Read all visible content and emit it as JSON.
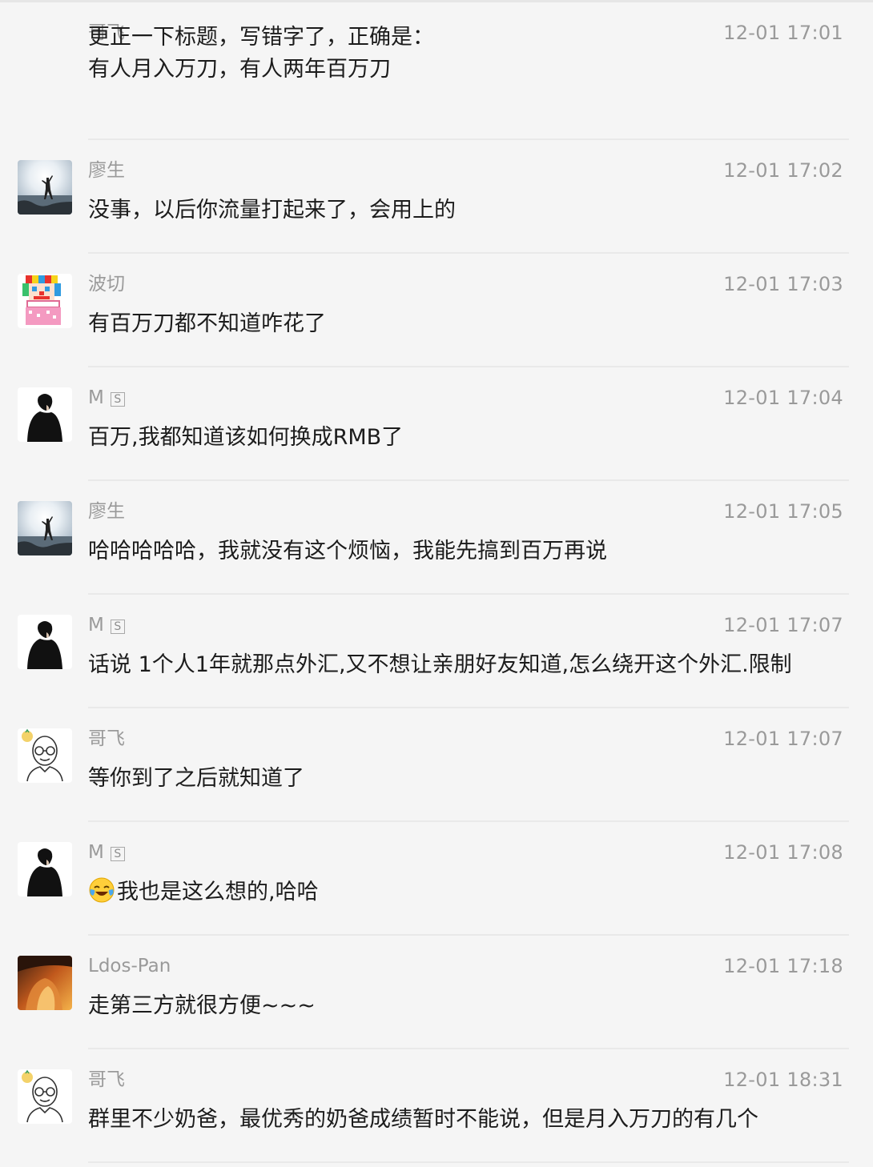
{
  "messages": [
    {
      "sender": "哥飞",
      "time": "12-01 17:01",
      "avatar": "none",
      "lines": [
        "更正一下标题，写错字了，正确是：",
        "有人月入万刀，有人两年百万刀"
      ]
    },
    {
      "sender": "廖生",
      "time": "12-01 17:02",
      "avatar": "silhouette-beach-photo",
      "lines": [
        "没事，以后你流量打起来了，会用上的"
      ]
    },
    {
      "sender": "波切",
      "time": "12-01 17:03",
      "avatar": "pixel-clown",
      "lines": [
        "有百万刀都不知道咋花了"
      ]
    },
    {
      "sender": "M",
      "sender_badge": "S",
      "time": "12-01 17:04",
      "avatar": "black-silhouette",
      "lines": [
        "百万,我都知道该如何换成RMB了"
      ]
    },
    {
      "sender": "廖生",
      "time": "12-01 17:05",
      "avatar": "silhouette-beach-photo",
      "lines": [
        "哈哈哈哈哈，我就没有这个烦恼，我能先搞到百万再说"
      ]
    },
    {
      "sender": "M",
      "sender_badge": "S",
      "time": "12-01 17:07",
      "avatar": "black-silhouette",
      "lines": [
        "话说 1个人1年就那点外汇,又不想让亲朋好友知道,怎么绕开这个外汇.限制"
      ]
    },
    {
      "sender": "哥飞",
      "time": "12-01 17:07",
      "avatar": "bald-glasses-cartoon",
      "lines": [
        "等你到了之后就知道了"
      ]
    },
    {
      "sender": "M",
      "sender_badge": "S",
      "time": "12-01 17:08",
      "avatar": "black-silhouette",
      "emoji": "laughing-crying-emoji",
      "lines": [
        "我也是这么想的,哈哈"
      ]
    },
    {
      "sender": "Ldos-Pan",
      "time": "12-01 17:18",
      "avatar": "sunset-hair-photo",
      "lines": [
        "走第三方就很方便~~~"
      ]
    },
    {
      "sender": "哥飞",
      "time": "12-01 18:31",
      "avatar": "bald-glasses-cartoon",
      "lines": [
        "群里不少奶爸，最优秀的奶爸成绩暂时不能说，但是月入万刀的有几个"
      ]
    }
  ]
}
